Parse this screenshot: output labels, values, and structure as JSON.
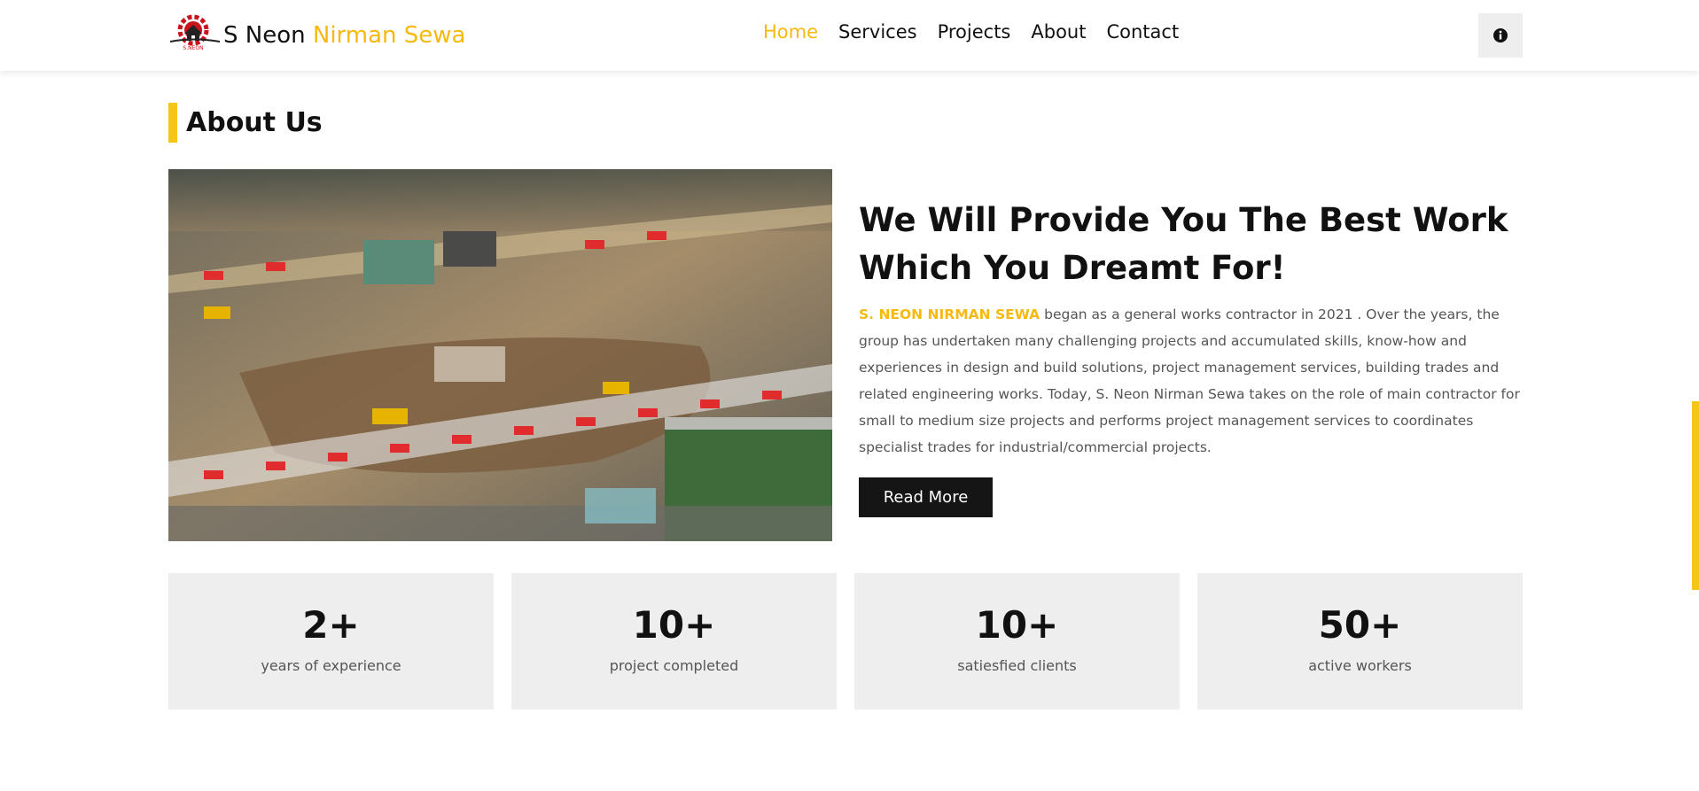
{
  "header": {
    "brand_part1": "S Neon",
    "brand_part2": "Nirman Sewa",
    "logo_text": "S.NEON",
    "nav": [
      "Home",
      "Services",
      "Projects",
      "About",
      "Contact"
    ],
    "active_nav": "Home",
    "info_icon": "info-icon"
  },
  "about": {
    "section_title": "About Us",
    "headline": "We Will Provide You The Best Work Which You Dreamt For!",
    "company_highlight": "S. NEON NIRMAN SEWA",
    "body": " began as a general works contractor in 2021 . Over the years, the group has undertaken many challenging projects and accumulated skills, know-how and experiences in design and build solutions, project management services, building trades and related engineering works. Today, S. Neon Nirman Sewa takes on the role of main contractor for small to medium size projects and performs project management services to coordinates specialist trades for industrial/commercial projects.",
    "read_more": "Read More"
  },
  "stats": [
    {
      "value": "2+",
      "label": "years of experience"
    },
    {
      "value": "10+",
      "label": "project completed"
    },
    {
      "value": "10+",
      "label": "satiesfied clients"
    },
    {
      "value": "50+",
      "label": "active workers"
    }
  ],
  "colors": {
    "accent": "#f5b910",
    "dark": "#151515",
    "card": "#eeeeee"
  }
}
